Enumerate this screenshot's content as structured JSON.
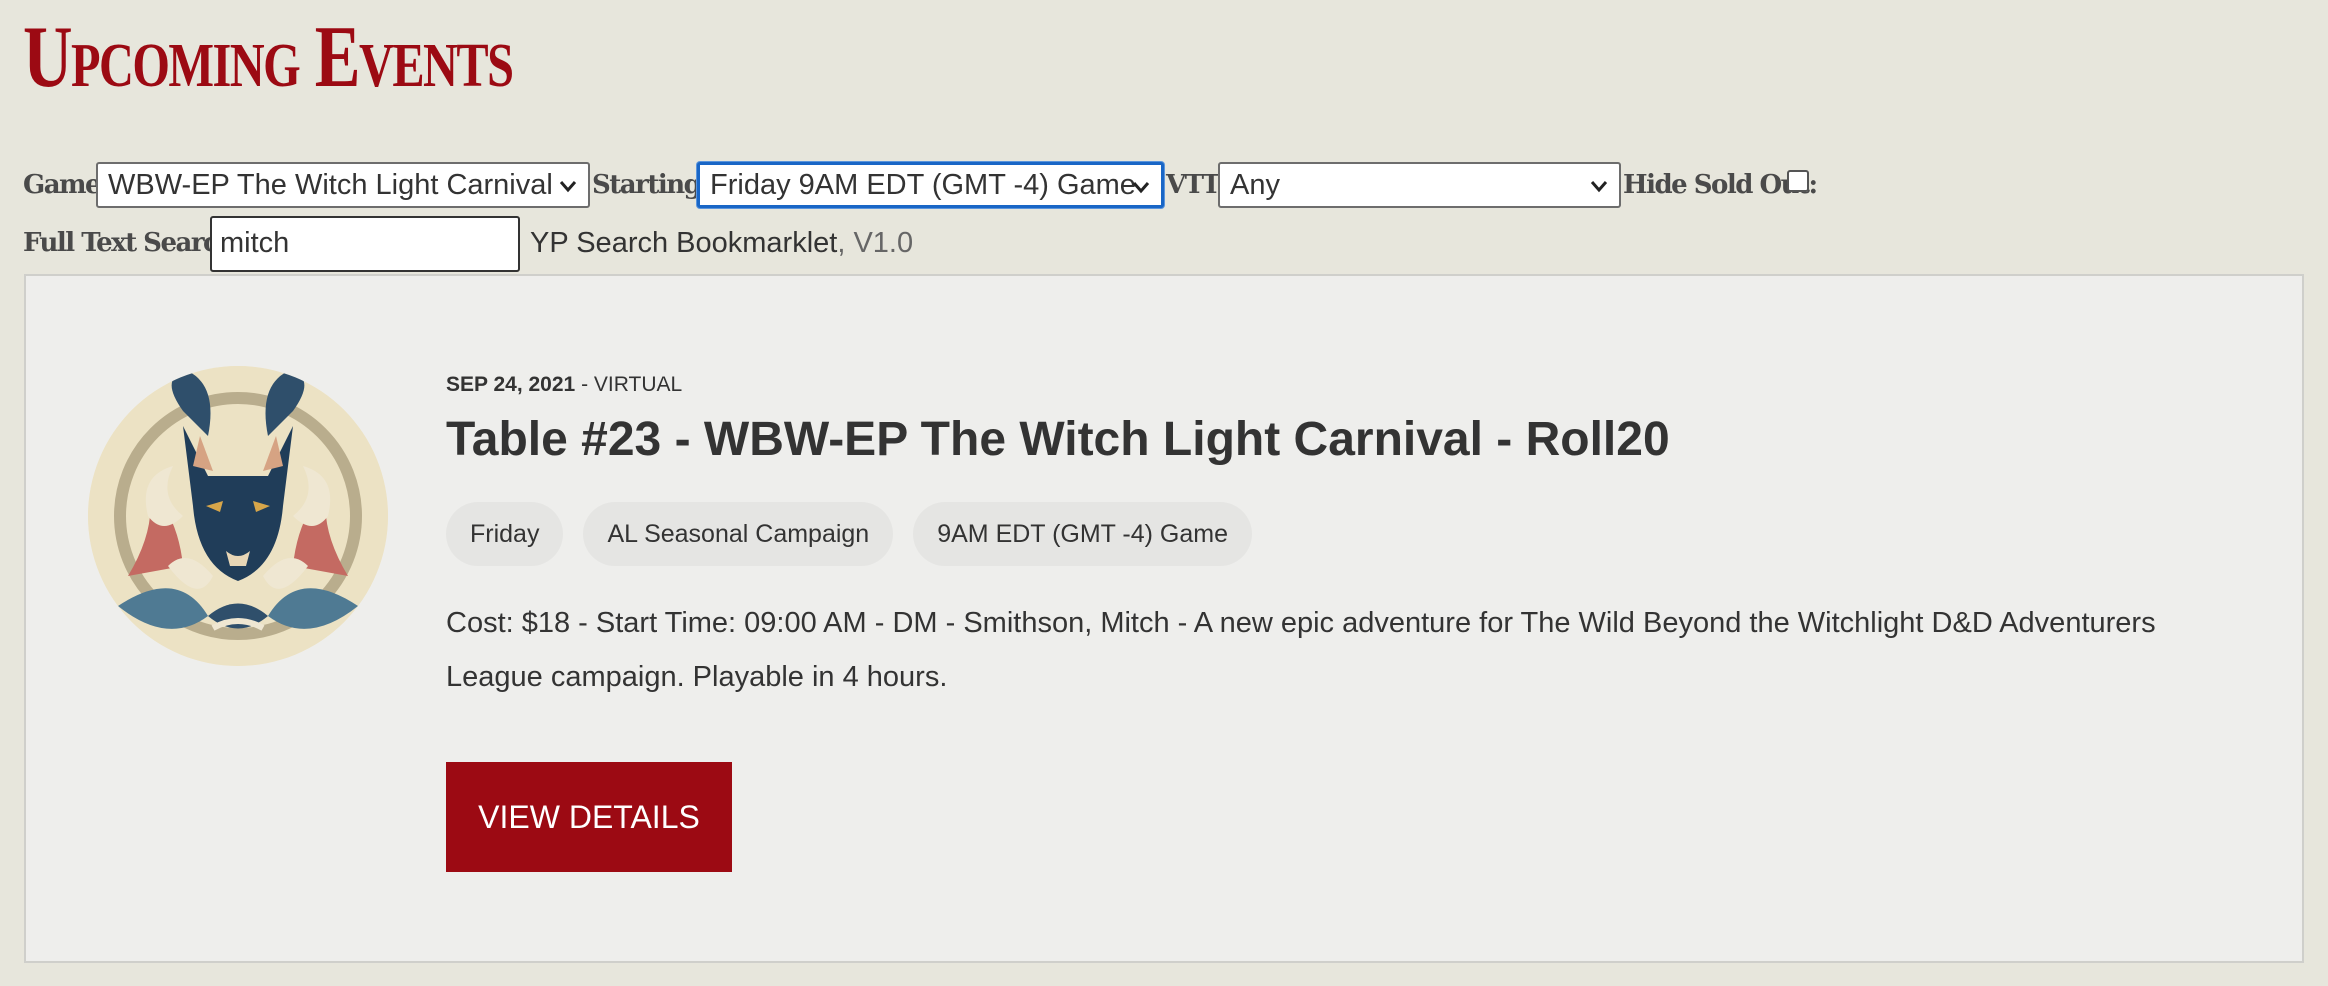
{
  "page": {
    "title": "Upcoming Events"
  },
  "filters": {
    "game": {
      "label": "Game:",
      "value": "WBW-EP The Witch Light Carnival"
    },
    "starting": {
      "label": "Starting:",
      "value": "Friday 9AM EDT (GMT -4) Game"
    },
    "vtt": {
      "label": "VTT:",
      "value": "Any"
    },
    "hide_sold_out": {
      "label": "Hide Sold Out:",
      "checked": false
    },
    "full_text_search": {
      "label": "Full Text Search:",
      "value": "mitch"
    },
    "bookmarklet": {
      "name": "YP Search Bookmarklet",
      "version": ", V1.0"
    }
  },
  "event": {
    "date": "SEP 24, 2021",
    "location": " - VIRTUAL",
    "title": "Table #23 - WBW-EP The Witch Light Carnival - Roll20",
    "tags": [
      "Friday",
      "AL Seasonal Campaign",
      "9AM EDT (GMT -4) Game"
    ],
    "description": "Cost: $18 - Start Time: 09:00 AM - DM - Smithson, Mitch - A new epic adventure for The Wild Beyond the Witchlight D&D Adventurers League campaign. Playable in 4 hours.",
    "cta_label": "VIEW DETAILS",
    "image_icon": "displacer-beast-emblem"
  },
  "colors": {
    "brand_red": "#9c0a13",
    "page_bg": "#e7e6dc",
    "card_bg": "#eeeeec",
    "focus_blue": "#1966c6"
  }
}
